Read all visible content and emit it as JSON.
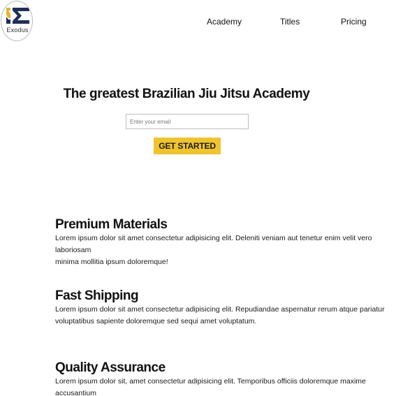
{
  "header": {
    "logo_text": "Exodus",
    "logo_colors": {
      "navy": "#1f2f57",
      "gold": "#e3b62e"
    },
    "nav": [
      {
        "label": "Academy"
      },
      {
        "label": "Titles"
      },
      {
        "label": "Pricing"
      }
    ]
  },
  "hero": {
    "title": "The greatest Brazilian Jiu Jitsu Academy",
    "email_placeholder": "Enter your email",
    "email_value": "",
    "cta_label": "GET STARTED",
    "cta_color": "#f0c32f"
  },
  "features": [
    {
      "title": "Premium Materials",
      "body": "Lorem ipsum dolor sit amet consectetur adipisicing elit. Deleniti veniam aut tenetur enim velit vero laboriosam\nminima mollitia ipsum doloremque!"
    },
    {
      "title": "Fast Shipping",
      "body": "Lorem ipsum dolor sit amet consectetur adipisicing elit. Repudiandae aspernatur rerum atque pariatur\nvoluptatibus sapiente doloremque sed sequi amet voluptatum."
    },
    {
      "title": "Quality Assurance",
      "body": "Lorem ipsum dolor sit, amet consectetur adipisicing elit. Temporibus officiis doloremque maxime accusantium\nquod. Cumque rem excepturi eum magnam dolorum!"
    }
  ]
}
